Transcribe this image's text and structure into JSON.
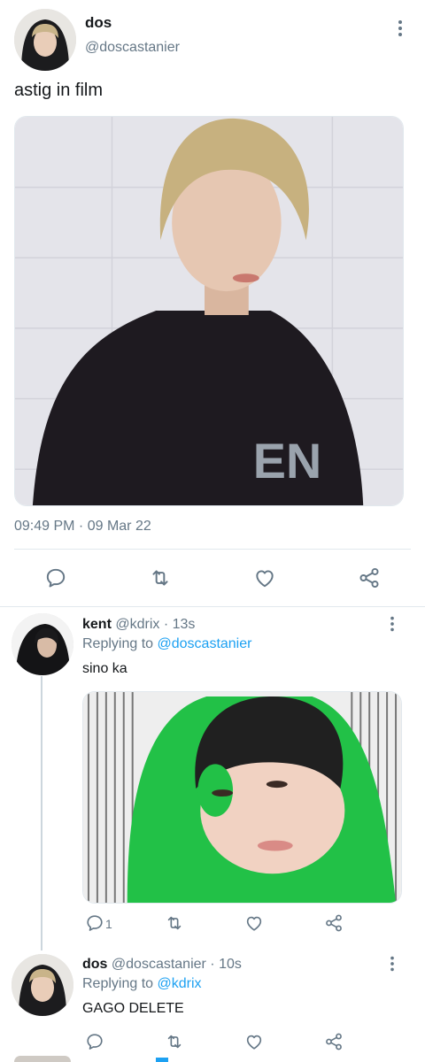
{
  "main_tweet": {
    "display_name": "dos",
    "handle": "@doscastanier",
    "text": "astig in film",
    "timestamp": "09:49 PM · 09 Mar 22",
    "media_description": "photo of a person with blonde hair in a black EN shirt",
    "media_shirt_text": "EN"
  },
  "replies": [
    {
      "display_name": "kent",
      "meta": " @kdrix · 13s",
      "replying_label": "Replying to ",
      "replying_to": "@doscastanier",
      "text": "sino ka",
      "reply_count": "1",
      "media_description": "photo of a person wearing a green hoodie and black beanie"
    },
    {
      "display_name": "dos",
      "meta": " @doscastanier · 10s",
      "replying_label": "Replying to ",
      "replying_to": "@kdrix",
      "text": "GAGO DELETE"
    }
  ],
  "icons": {
    "reply": "reply-icon",
    "retweet": "retweet-icon",
    "like": "heart-icon",
    "share": "share-icon",
    "more": "more-vertical-icon"
  },
  "colors": {
    "text": "#14171a",
    "secondary": "#657786",
    "link": "#1da1f2",
    "divider": "#e1e8ed"
  }
}
